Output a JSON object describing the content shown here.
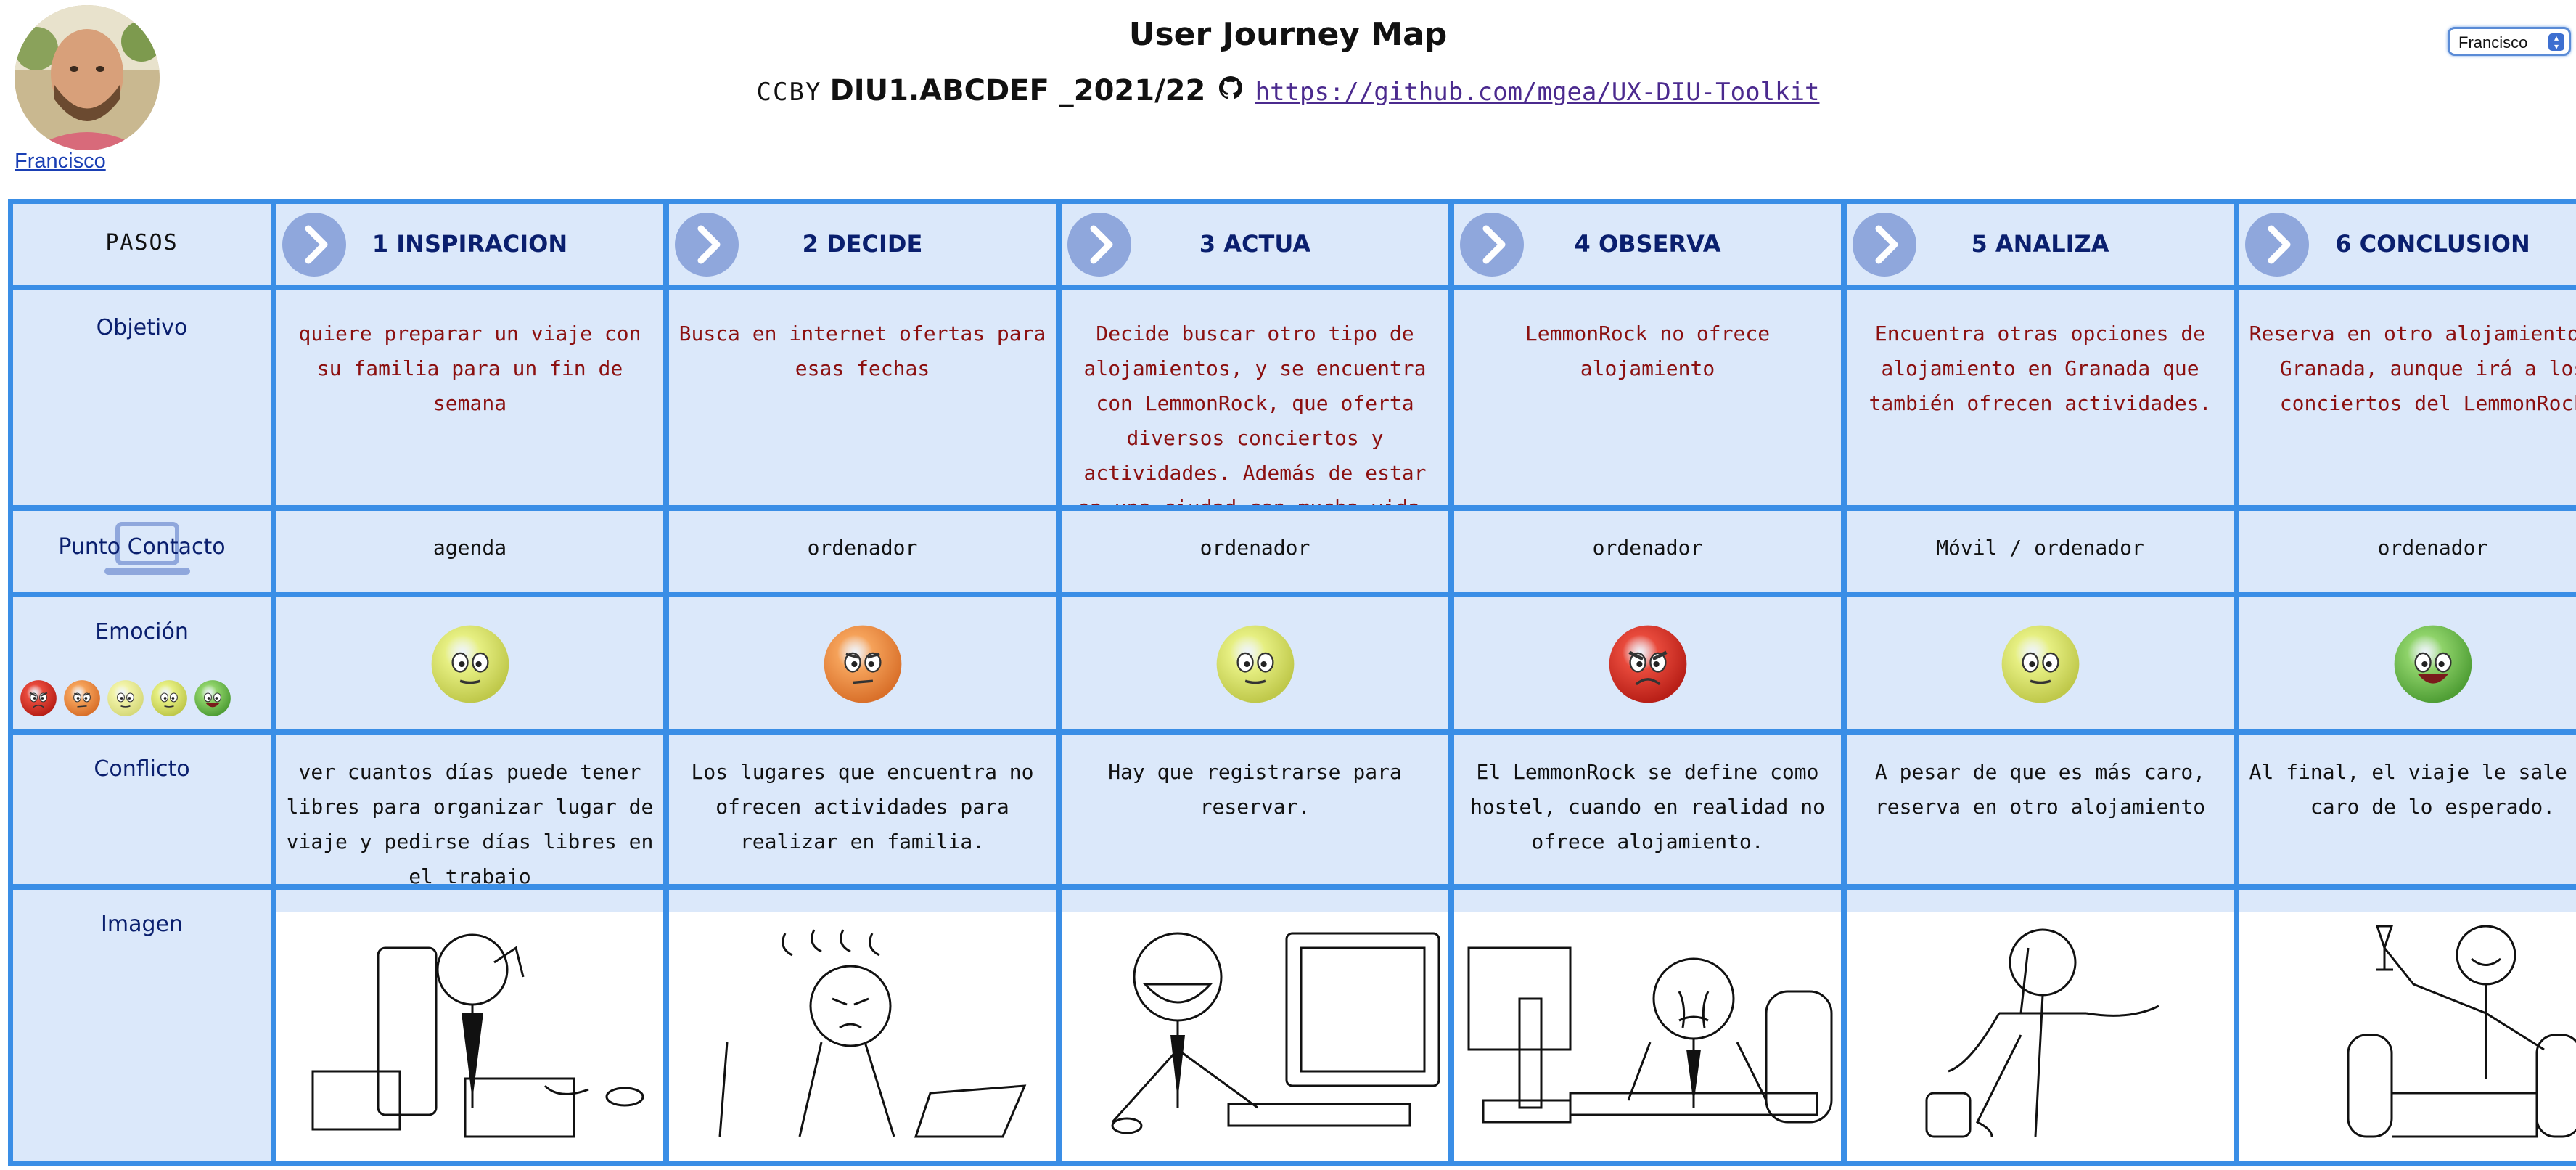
{
  "header": {
    "title": "User Journey Map",
    "license": "CCBY",
    "course_code": "DIU1.ABCDEF _2021/22",
    "repo_link": "https://github.com/mgea/UX-DIU-Toolkit",
    "avatar_name": "Francisco",
    "user_select_value": "Francisco"
  },
  "rows": {
    "pasos": "PASOS",
    "objetivo": "Objetivo",
    "punto_contacto": "Punto Contacto",
    "emocion": "Emoción",
    "conflicto": "Conflicto",
    "imagen": "Imagen"
  },
  "steps": [
    {
      "title": "1 INSPIRACION",
      "objetivo": "quiere preparar un viaje con su familia para un fin de semana",
      "contacto": "agenda",
      "emotion": "neutral",
      "conflicto": "ver cuantos días puede tener libres para organizar lugar de viaje y pedirse días libres en el trabajo",
      "image": "person-on-phone-at-desk"
    },
    {
      "title": "2 DECIDE",
      "objetivo": "Busca en internet ofertas para esas fechas",
      "contacto": "ordenador",
      "emotion": "annoyed",
      "conflicto": "Los lugares que encuentra no ofrecen actividades para realizar en familia.",
      "image": "frustrated-person-at-laptop"
    },
    {
      "title": "3 ACTUA",
      "objetivo": "Decide buscar otro tipo de alojamientos, y se encuentra con LemmonRock, que oferta diversos conciertos y actividades. Además de estar en una ciudad con mucha vida.",
      "contacto": "ordenador",
      "emotion": "neutral",
      "conflicto": "Hay que registrarse para reservar.",
      "image": "smiling-person-at-computer"
    },
    {
      "title": "4 OBSERVA",
      "objetivo": "LemmonRock no ofrece alojamiento",
      "contacto": "ordenador",
      "emotion": "angry",
      "conflicto": "El LemmonRock se define como hostel, cuando en realidad no ofrece alojamiento.",
      "image": "crying-person-at-computer"
    },
    {
      "title": "5 ANALIZA",
      "objetivo": "Encuentra otras opciones de alojamiento en Granada que también ofrecen actividades.",
      "contacto": "Móvil / ordenador",
      "emotion": "neutral",
      "conflicto": "A pesar de que es más caro, reserva en otro alojamiento",
      "image": "person-on-phone-standing"
    },
    {
      "title": "6 CONCLUSION",
      "objetivo": "Reserva en otro alojamiento en Granada, aunque irá a los conciertos del LemmonRock",
      "contacto": "ordenador",
      "emotion": "happy",
      "conflicto": "Al final, el viaje le sale más caro de lo esperado.",
      "image": "person-toasting-in-armchair"
    }
  ],
  "emotion_scale": [
    "angry",
    "annoyed",
    "neutral-pale",
    "neutral",
    "happy"
  ],
  "colors": {
    "grid_border": "#3a8ee6",
    "cell_bg": "#dbe8fa",
    "objetivo_text": "#8b1010",
    "label_text": "#0a1f6e",
    "chevron": "#8fa7dc"
  }
}
